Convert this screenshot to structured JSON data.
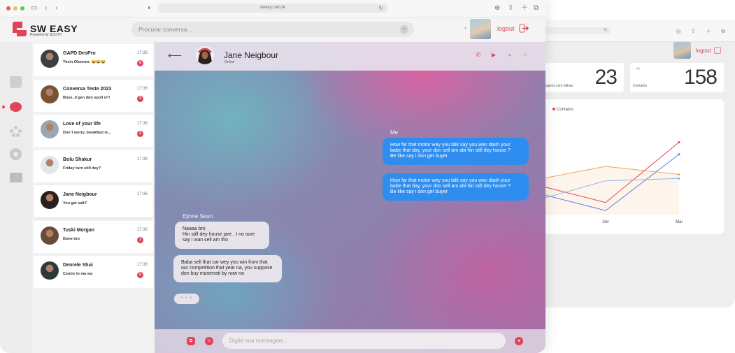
{
  "browser": {
    "url": "swesy.com.br",
    "back_url": "",
    "buttons": [
      "back",
      "forward",
      "sidebar",
      "share",
      "new-tab",
      "tabs"
    ]
  },
  "header": {
    "brand_title": "SW EASY",
    "brand_subtitle": "Powered by SOUTH",
    "search_placeholder": "Procurar conversa...",
    "logout_label": "logout",
    "accent_color": "#e0435a"
  },
  "nav": {
    "items": [
      "home-icon",
      "chat-icon",
      "users-icon",
      "settings-icon",
      "folder-icon"
    ],
    "active": "chat-icon"
  },
  "conversations": [
    {
      "name": "GAPD DesPro",
      "message": "Tosin Okeowo: 😂😂😂",
      "time": "17:36",
      "unread": "5"
    },
    {
      "name": "Conversa Teste 2023",
      "message": "Boss, d gen don spoil o!!!",
      "time": "17:36",
      "unread": "3"
    },
    {
      "name": "Love of your life",
      "message": "Don`t worry, breakfast is...",
      "time": "17:36",
      "unread": "2"
    },
    {
      "name": "Bolu Shakur",
      "message": "Friday turn still dey?",
      "time": "17:36",
      "unread": ""
    },
    {
      "name": "Jane Neigbour",
      "message": "You get salt?",
      "time": "17:36",
      "unread": ""
    },
    {
      "name": "Tuski Morgan",
      "message": "Done bro",
      "time": "17:36",
      "unread": "1"
    },
    {
      "name": "Denrele Shui",
      "message": "Centre lo ma wa",
      "time": "17:36",
      "unread": "5"
    }
  ],
  "chat": {
    "contact_name": "Jane Neigbour",
    "contact_status": "Online",
    "actions": [
      "phone-icon",
      "video-icon",
      "search-icon",
      "more-icon"
    ],
    "outgoing_sender": "Me",
    "outgoing": [
      "How far that motor wey you talk say you wan dash your babe that day, your don sell am abi hin still dey house ?\nBe like say i don get buyer",
      "How far that motor wey you talk say you wan dash your babe that day, your don sell am abi hin still dey house ?\nBe like say i don get buyer"
    ],
    "incoming_sender": "Ejinne Seun",
    "incoming": [
      "Naaaa bro\nHin still dey house jare , I no sure say i wan sell am tho",
      "Baba sell that car wey you win from that our competition that year na, you suppose don buy maserrati by now na"
    ],
    "typing_indicator": "• • •",
    "composer_placeholder": "Digite sua mensagem..."
  },
  "dashboard": {
    "logout_label": "logout",
    "kpis": [
      {
        "value": "23",
        "label": "agens com falhas"
      },
      {
        "value": "158",
        "label": "Contatos",
        "badge": "+5"
      }
    ],
    "chart_data": {
      "type": "line",
      "legend": [
        "Contatos"
      ],
      "x": [
        "",
        "Abr",
        "Mai"
      ],
      "series": [
        {
          "name": "",
          "color": "#f2a65a",
          "values": [
            0.45,
            0.6,
            0.5
          ]
        },
        {
          "name": "",
          "color": "#e0435a",
          "values": [
            0.35,
            0.15,
            0.9
          ]
        },
        {
          "name": "",
          "color": "#5b7ee0",
          "values": [
            0.25,
            0.05,
            0.75
          ]
        },
        {
          "name": "",
          "color": "#8fb6ea",
          "values": [
            0.2,
            0.42,
            0.45
          ]
        }
      ]
    }
  }
}
